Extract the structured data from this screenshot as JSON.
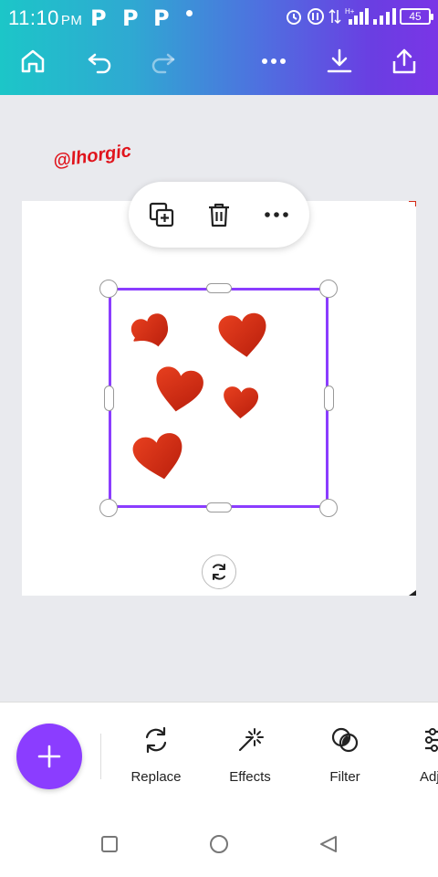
{
  "status_bar": {
    "time": "11:10",
    "ampm": "PM",
    "notification_icons": [
      "P",
      "P",
      "P"
    ],
    "battery": "45"
  },
  "toolbar": {
    "icons": [
      "home-icon",
      "undo-icon",
      "redo-icon",
      "more-icon",
      "download-icon",
      "share-icon"
    ]
  },
  "canvas": {
    "watermark": "@lhorgic",
    "context_menu": [
      "duplicate-icon",
      "delete-icon",
      "more-icon"
    ]
  },
  "colors": {
    "accent": "#8b3dff",
    "gradient_start": "#1cc6c8",
    "gradient_end": "#7a35e6",
    "heart": "#d42a14"
  },
  "bottom_toolbar": {
    "items": [
      {
        "label": "Replace",
        "icon": "replace-icon"
      },
      {
        "label": "Effects",
        "icon": "effects-icon"
      },
      {
        "label": "Filter",
        "icon": "filter-icon"
      },
      {
        "label": "Adj",
        "icon": "adjust-icon"
      }
    ]
  },
  "navbar": [
    "recents-icon",
    "home-icon",
    "back-icon"
  ]
}
